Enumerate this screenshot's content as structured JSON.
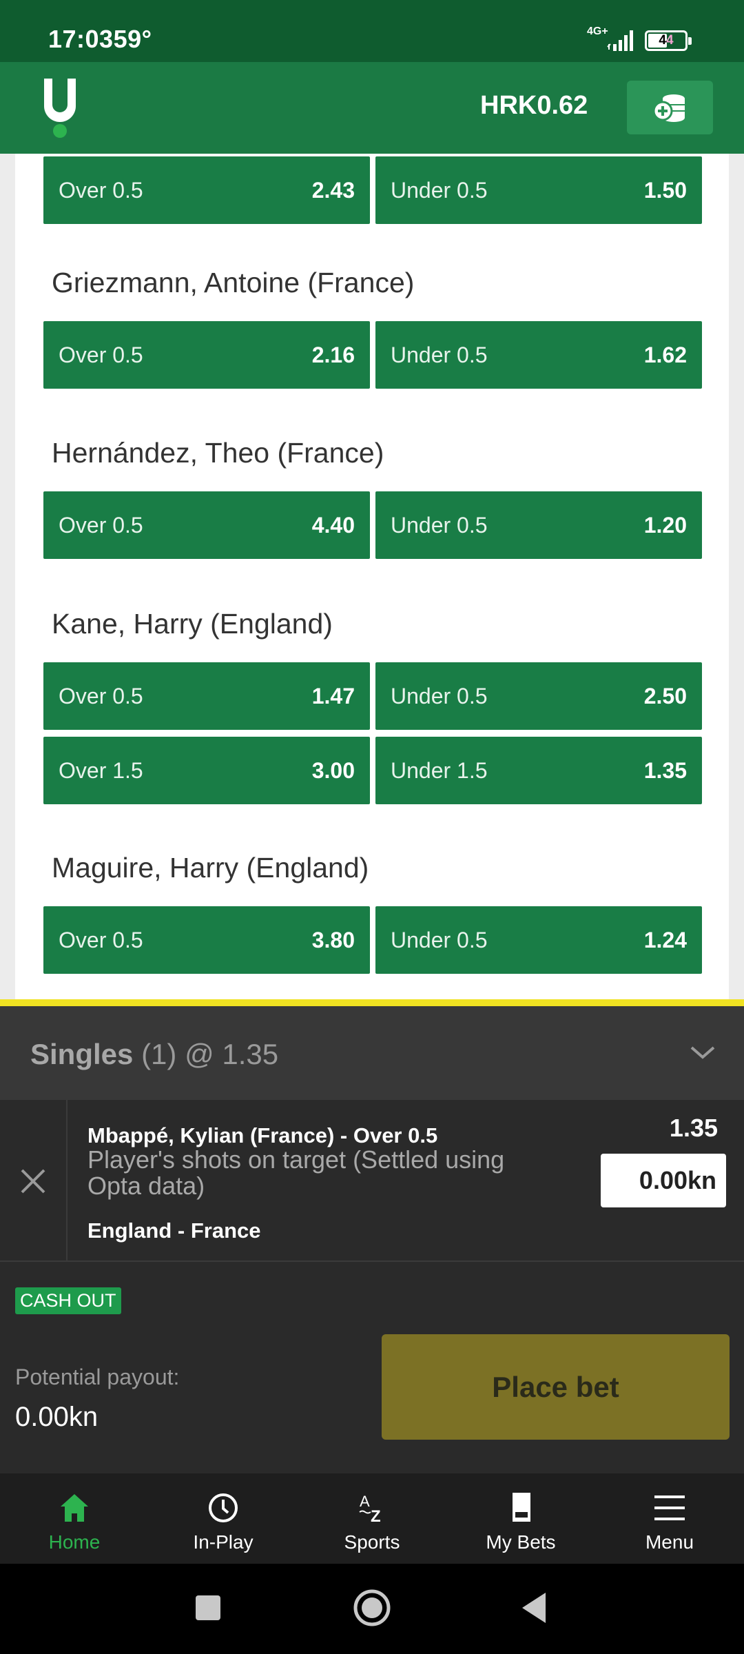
{
  "status_bar": {
    "time": "17:03",
    "temperature": "59°",
    "network": "4G+",
    "battery": "44"
  },
  "header": {
    "balance": "HRK0.62"
  },
  "markets": [
    {
      "name": "",
      "odds": [
        {
          "label": "Over 0.5",
          "value": "2.43"
        },
        {
          "label": "Under 0.5",
          "value": "1.50"
        }
      ]
    },
    {
      "name": "Griezmann, Antoine (France)",
      "odds": [
        {
          "label": "Over 0.5",
          "value": "2.16"
        },
        {
          "label": "Under 0.5",
          "value": "1.62"
        }
      ]
    },
    {
      "name": "Hernández, Theo (France)",
      "odds": [
        {
          "label": "Over 0.5",
          "value": "4.40"
        },
        {
          "label": "Under 0.5",
          "value": "1.20"
        }
      ]
    },
    {
      "name": "Kane, Harry (England)",
      "odds": [
        {
          "label": "Over 0.5",
          "value": "1.47"
        },
        {
          "label": "Under 0.5",
          "value": "2.50"
        },
        {
          "label": "Over 1.5",
          "value": "3.00"
        },
        {
          "label": "Under 1.5",
          "value": "1.35"
        }
      ]
    },
    {
      "name": "Maguire, Harry (England)",
      "odds": [
        {
          "label": "Over 0.5",
          "value": "3.80"
        },
        {
          "label": "Under 0.5",
          "value": "1.24"
        }
      ]
    }
  ],
  "betslip": {
    "title": "Singles",
    "count": "(1)",
    "total_odds": "@ 1.35",
    "selection": {
      "name": "Mbappé, Kylian (France) - Over 0.5",
      "market": "Player's shots on target (Settled using Opta data)",
      "event": "England - France",
      "odds": "1.35",
      "stake": "0.00kn"
    },
    "cashout_label": "CASH OUT",
    "payout_label": "Potential payout:",
    "payout_value": "0.00kn",
    "place_bet_label": "Place bet"
  },
  "bottom_nav": [
    {
      "label": "Home",
      "icon": "home-icon",
      "active": true
    },
    {
      "label": "In-Play",
      "icon": "clock-icon",
      "active": false
    },
    {
      "label": "Sports",
      "icon": "az-icon",
      "active": false
    },
    {
      "label": "My Bets",
      "icon": "betslip-icon",
      "active": false
    },
    {
      "label": "Menu",
      "icon": "hamburger-icon",
      "active": false
    }
  ],
  "colors": {
    "brand_green": "#1b7a44",
    "odds_green": "#197d46",
    "active_nav": "#2db34f",
    "slip_border": "#f0e222",
    "place_bet": "#7c7125"
  }
}
